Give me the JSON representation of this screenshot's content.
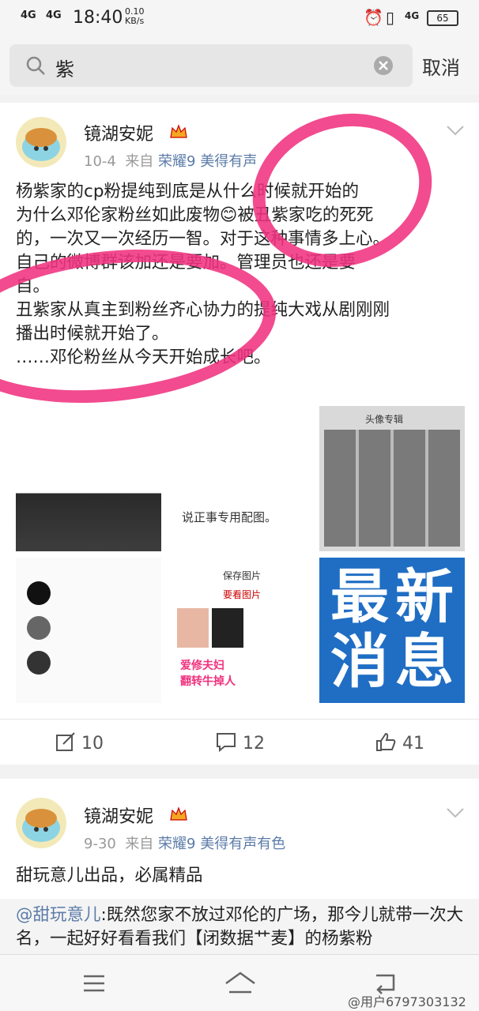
{
  "status": {
    "sig1": "4G",
    "sig2": "4G",
    "time": "18:40",
    "speed": "0.10",
    "speed_unit": "KB/s",
    "net": "4G",
    "battery": "65"
  },
  "search": {
    "query": "紫",
    "cancel": "取消"
  },
  "post1": {
    "username": "镜湖安妮",
    "date": "10-4",
    "from": "来自",
    "source": "荣耀9 美得有声",
    "lines": [
      "杨紫家的cp粉提纯到底是从什么时候就开始的",
      "为什么邓伦家粉丝如此废物😊被丑紫家吃的死死",
      "的，一次又一次经历一智。对于这种事情多上心。",
      "自己的微博群该加还是要加。管理员也还是要",
      "自。",
      "丑紫家从真主到粉丝齐心协力的提纯大戏从剧刚刚",
      "播出时候就开始了。",
      "……邓伦粉丝从今天开始成长吧。"
    ],
    "img_texts": {
      "t2": "说正事专用配图。",
      "t5a": "保存图片",
      "t5b": "要看图片",
      "t5c": "爱修夫妇",
      "t5d": "翻转牛掉人",
      "t6a": "最",
      "t6b": "新",
      "t6c": "消",
      "t6d": "息",
      "t3": "头像专辑"
    },
    "repost_count": "10",
    "comment_count": "12",
    "like_count": "41"
  },
  "post2": {
    "username": "镜湖安妮",
    "date": "9-30",
    "from": "来自",
    "source": "荣耀9 美得有声有色",
    "text": "甜玩意儿出品，必属精品",
    "quote_mention": "@甜玩意儿",
    "quote_text": ":既然您家不放过邓伦的广场，那今儿就带一次大名，一起好好看看我们【闭数据艹麦】的杨紫粉"
  },
  "watermark": "@用户6797303132",
  "colors": {
    "accent": "#f0327f",
    "link": "#5b7ba8"
  }
}
